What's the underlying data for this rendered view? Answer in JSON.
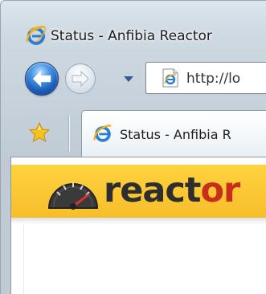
{
  "window": {
    "title": "Status - Anfibia Reactor"
  },
  "navigation": {
    "address_url": "http://lo"
  },
  "tabs": [
    {
      "label": "Status - Anfibia R",
      "active": true
    }
  ],
  "page": {
    "logo_part1": "react",
    "logo_part2": "or"
  },
  "colors": {
    "banner": "#f7be2a",
    "logo_dark": "#2e2e2e",
    "logo_accent": "#c92e1c"
  },
  "icons": {
    "title": "ie-logo-icon",
    "back": "back-arrow-icon",
    "forward": "forward-arrow-icon",
    "history": "chevron-down-icon",
    "page": "ie-page-icon",
    "favorites": "favorites-star-icon",
    "tab": "ie-logo-icon",
    "logo": "speedometer-icon"
  }
}
